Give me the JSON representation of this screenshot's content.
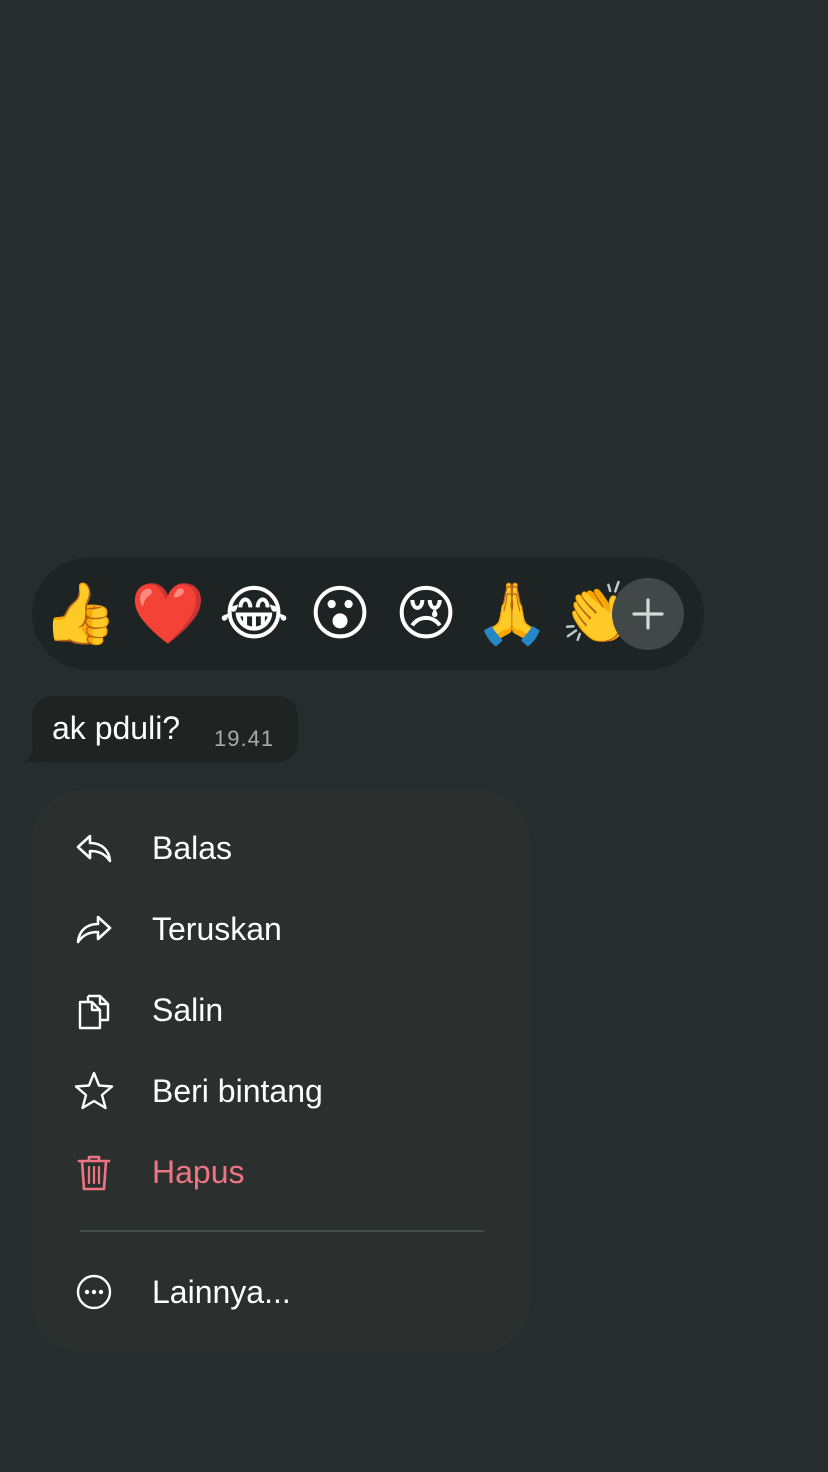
{
  "reactions": {
    "emojis": [
      "👍",
      "❤️",
      "😂",
      "😮",
      "😢",
      "🙏",
      "👏"
    ],
    "more_icon": "plus-icon"
  },
  "message": {
    "text": "ak pduli?",
    "time": "19.41"
  },
  "menu": {
    "items": [
      {
        "label": "Balas",
        "icon": "reply-icon"
      },
      {
        "label": "Teruskan",
        "icon": "forward-icon"
      },
      {
        "label": "Salin",
        "icon": "copy-icon"
      },
      {
        "label": "Beri bintang",
        "icon": "star-icon"
      },
      {
        "label": "Hapus",
        "icon": "trash-icon",
        "color": "#f07583"
      },
      {
        "label": "Lainnya...",
        "icon": "more-icon"
      }
    ]
  },
  "colors": {
    "background": "#262d2c",
    "menu_bg": "#2b302f",
    "bubble_bg": "#1f2423",
    "danger": "#f07583"
  }
}
